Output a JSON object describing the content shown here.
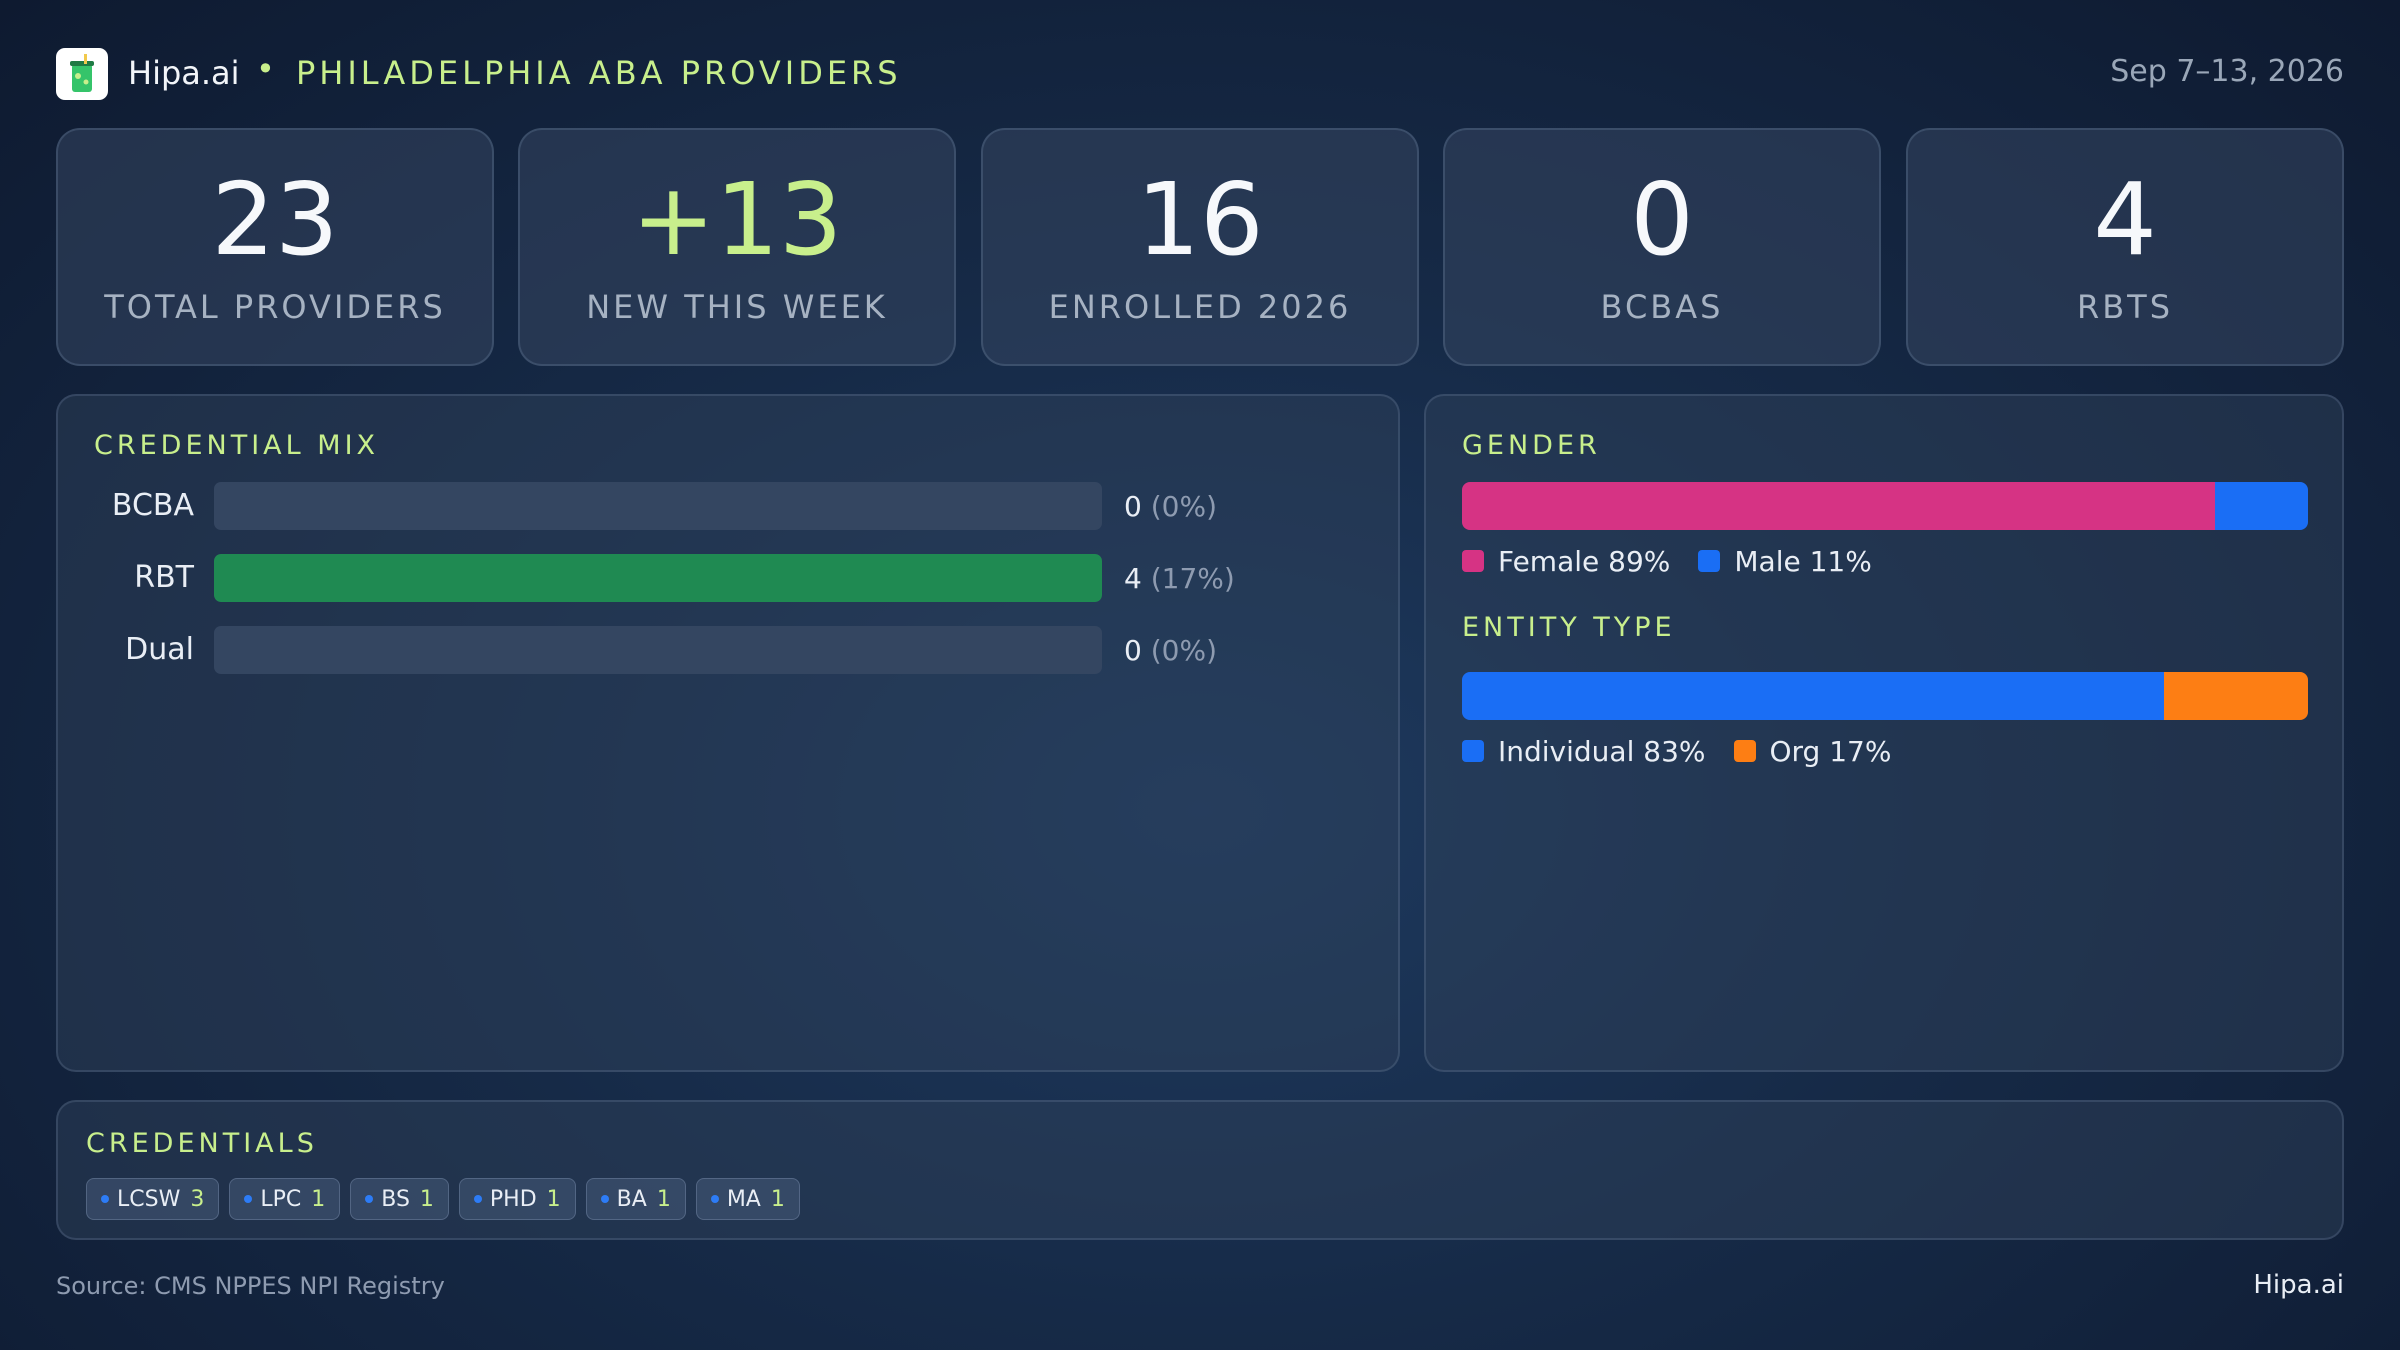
{
  "header": {
    "brand": "Hipa.ai",
    "separator": "•",
    "title": "PHILADELPHIA ABA PROVIDERS",
    "date_range": "Sep 7–13, 2026",
    "logo_icon": "drink-cup-icon"
  },
  "stats": [
    {
      "value": "23",
      "label": "TOTAL PROVIDERS"
    },
    {
      "value": "+13",
      "label": "NEW THIS WEEK"
    },
    {
      "value": "16",
      "label": "ENROLLED 2026"
    },
    {
      "value": "0",
      "label": "BCBAS"
    },
    {
      "value": "4",
      "label": "RBTS"
    }
  ],
  "credential_mix": {
    "title": "CREDENTIAL MIX",
    "rows": [
      {
        "name": "BCBA",
        "count": "0",
        "pct": "(0%)",
        "fraction": 0
      },
      {
        "name": "RBT",
        "count": "4",
        "pct": "(17%)",
        "fraction": 1
      },
      {
        "name": "Dual",
        "count": "0",
        "pct": "(0%)",
        "fraction": 0
      }
    ],
    "fill_color": "#1f8a52"
  },
  "gender": {
    "title": "GENDER",
    "segments": [
      {
        "label": "Female 89%",
        "percent": 89,
        "color": "#d63384"
      },
      {
        "label": "Male 11%",
        "percent": 11,
        "color": "#1a6ef5"
      }
    ]
  },
  "entity_type": {
    "title": "ENTITY TYPE",
    "segments": [
      {
        "label": "Individual 83%",
        "percent": 83,
        "color": "#1a6ef5"
      },
      {
        "label": "Org 17%",
        "percent": 17,
        "color": "#fd7e14"
      }
    ]
  },
  "credentials": {
    "title": "CREDENTIALS",
    "chips": [
      {
        "name": "LCSW",
        "count": "3"
      },
      {
        "name": "LPC",
        "count": "1"
      },
      {
        "name": "BS",
        "count": "1"
      },
      {
        "name": "PHD",
        "count": "1"
      },
      {
        "name": "BA",
        "count": "1"
      },
      {
        "name": "MA",
        "count": "1"
      }
    ]
  },
  "footer": {
    "source": "Source: CMS NPPES NPI Registry",
    "brand": "Hipa.ai"
  }
}
